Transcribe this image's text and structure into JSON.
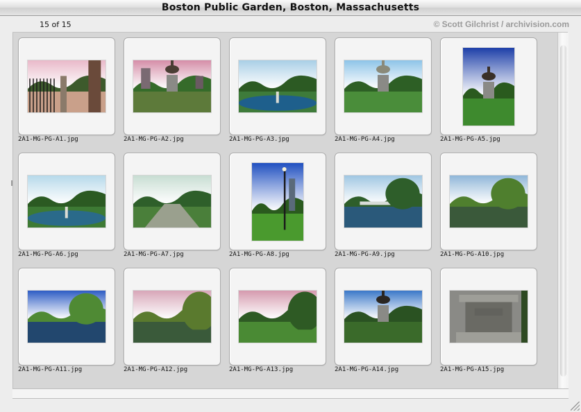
{
  "window": {
    "title": "Boston Public Garden, Boston, Massachusetts"
  },
  "header": {
    "count": "15 of 15",
    "copyright": "© Scott Gilchrist / archivision.com"
  },
  "thumbnails": [
    {
      "filename": "2A1-MG-PG-A1.jpg",
      "orientation": "landscape",
      "subject": "iron-gate-entrance",
      "colors": {
        "sky": "#e9b9c9",
        "ground": "#c9a08a",
        "foliage": "#3d5a2c",
        "feature": "#1a1a1a"
      }
    },
    {
      "filename": "2A1-MG-PG-A2.jpg",
      "orientation": "landscape",
      "subject": "statue-with-city",
      "colors": {
        "sky": "#d58ea8",
        "ground": "#5d7a3a",
        "foliage": "#356b2a",
        "feature": "#4a3d34"
      }
    },
    {
      "filename": "2A1-MG-PG-A3.jpg",
      "orientation": "landscape",
      "subject": "fountain-pool",
      "colors": {
        "sky": "#a9cfe6",
        "ground": "#3e7b3a",
        "foliage": "#2c5a23",
        "feature": "#1e5f8c"
      }
    },
    {
      "filename": "2A1-MG-PG-A4.jpg",
      "orientation": "landscape",
      "subject": "path-to-statue",
      "colors": {
        "sky": "#8ec4e8",
        "ground": "#4a8d3a",
        "foliage": "#2d5f25",
        "feature": "#8a8a7a"
      }
    },
    {
      "filename": "2A1-MG-PG-A5.jpg",
      "orientation": "portrait",
      "subject": "equestrian-statue",
      "colors": {
        "sky": "#1d3fa8",
        "ground": "#3e8a2e",
        "foliage": "#2a5a1e",
        "feature": "#3a3028"
      }
    },
    {
      "filename": "2A1-MG-PG-A6.jpg",
      "orientation": "landscape",
      "subject": "pool-and-trees",
      "colors": {
        "sky": "#b6d9ea",
        "ground": "#3d7a34",
        "foliage": "#2b5a22",
        "feature": "#2a6a8a"
      }
    },
    {
      "filename": "2A1-MG-PG-A7.jpg",
      "orientation": "landscape",
      "subject": "garden-path",
      "colors": {
        "sky": "#c7ddd2",
        "ground": "#4a7f3a",
        "foliage": "#2e5f2a",
        "feature": "#9aa08e"
      }
    },
    {
      "filename": "2A1-MG-PG-A8.jpg",
      "orientation": "portrait",
      "subject": "lamp-and-lawn",
      "colors": {
        "sky": "#1f4fc0",
        "ground": "#4a9a2e",
        "foliage": "#2a5a1e",
        "feature": "#1a1a1a"
      }
    },
    {
      "filename": "2A1-MG-PG-A9.jpg",
      "orientation": "landscape",
      "subject": "lagoon-bridge",
      "colors": {
        "sky": "#9fc6e2",
        "ground": "#2a5a7a",
        "foliage": "#2e5e2a",
        "feature": "#d8dcd8"
      }
    },
    {
      "filename": "2A1-MG-PG-A10.jpg",
      "orientation": "landscape",
      "subject": "willow-lagoon",
      "colors": {
        "sky": "#8fb6d8",
        "ground": "#3a5a3a",
        "foliage": "#4f7f2e",
        "feature": "#c0c4b8"
      }
    },
    {
      "filename": "2A1-MG-PG-A11.jpg",
      "orientation": "landscape",
      "subject": "willows-water",
      "colors": {
        "sky": "#2d5cc4",
        "ground": "#23486e",
        "foliage": "#4f8a34",
        "feature": "#6a9a3e"
      }
    },
    {
      "filename": "2A1-MG-PG-A12.jpg",
      "orientation": "landscape",
      "subject": "pink-sky-willow",
      "colors": {
        "sky": "#d7a6b8",
        "ground": "#3a5a3a",
        "foliage": "#5a7a2e",
        "feature": "#7a8a4a"
      }
    },
    {
      "filename": "2A1-MG-PG-A13.jpg",
      "orientation": "landscape",
      "subject": "pink-sky-lawn",
      "colors": {
        "sky": "#d59aae",
        "ground": "#4a8a34",
        "foliage": "#2e5a24",
        "feature": "#3a3a3a"
      }
    },
    {
      "filename": "2A1-MG-PG-A14.jpg",
      "orientation": "landscape",
      "subject": "equestrian-blue",
      "colors": {
        "sky": "#3a78c8",
        "ground": "#3a6a2a",
        "foliage": "#2a5222",
        "feature": "#2a2622"
      }
    },
    {
      "filename": "2A1-MG-PG-A15.jpg",
      "orientation": "landscape",
      "subject": "granite-pedestal",
      "colors": {
        "sky": "#8a8a86",
        "ground": "#5a5a56",
        "foliage": "#6a6a64",
        "feature": "#9e9e98"
      }
    }
  ]
}
